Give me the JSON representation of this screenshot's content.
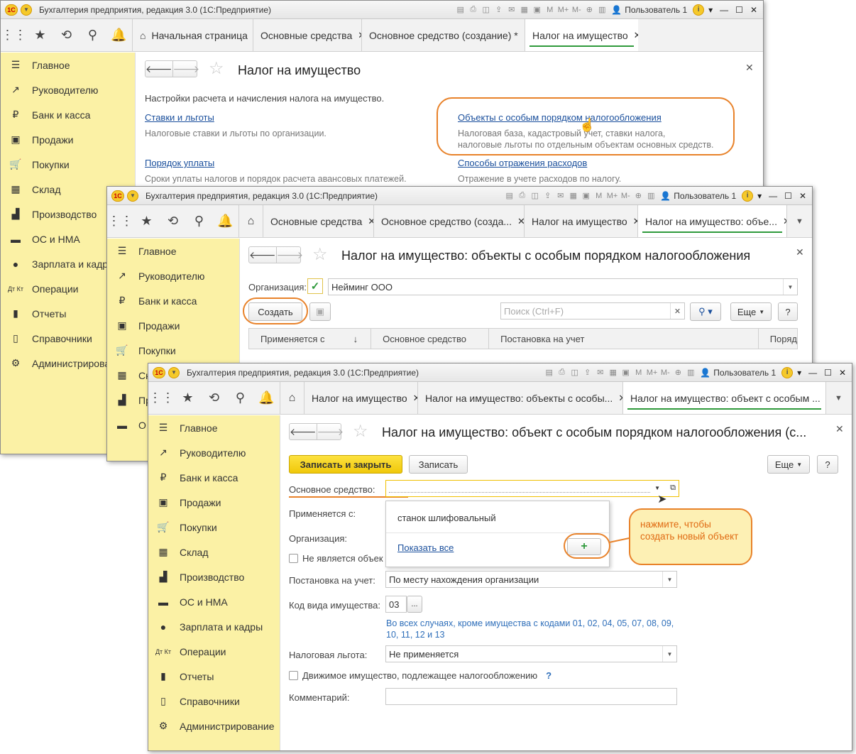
{
  "app_title": "Бухгалтерия предприятия, редакция 3.0 (1С:Предприятие)",
  "user": "Пользователь 1",
  "logo": "1С",
  "sidebar": [
    "Главное",
    "Руководителю",
    "Банк и касса",
    "Продажи",
    "Покупки",
    "Склад",
    "Производство",
    "ОС и НМА",
    "Зарплата и кадры",
    "Операции",
    "Отчеты",
    "Справочники",
    "Администрирование"
  ],
  "sidebar_w1_visible": {
    "zarplata": "Зарплата и кадр",
    "admin": "Администрирова"
  },
  "sidebar_w2_visible": {
    "sklad": "Ск",
    "proizv": "Пр",
    "os": "О"
  },
  "w1": {
    "tabs": [
      "Начальная страница",
      "Основные средства",
      "Основное средство (создание) *",
      "Налог на имущество"
    ],
    "title": "Налог на имущество",
    "intro": "Настройки расчета и начисления налога на имущество.",
    "link1": "Ставки и льготы",
    "hint1": "Налоговые ставки и льготы по организации.",
    "link2": "Объекты с особым порядком налогообложения",
    "hint2a": "Налоговая база, кадастровый учет, ставки налога,",
    "hint2b": "налоговые льготы по отдельным объектам основных средств.",
    "link3": "Порядок уплаты",
    "hint3": "Сроки уплаты налогов и порядок расчета авансовых платежей.",
    "link4": "Способы отражения расходов",
    "hint4": "Отражение в учете расходов по налогу."
  },
  "w2": {
    "tabs": [
      "Основные средства",
      "Основное средство (созда...",
      "Налог на имущество",
      "Налог на имущество: объе..."
    ],
    "title": "Налог на имущество: объекты с особым порядком налогообложения",
    "org_label": "Организация:",
    "org_value": "Нейминг ООО",
    "create": "Создать",
    "search_placeholder": "Поиск (Ctrl+F)",
    "more": "Еще",
    "help": "?",
    "cols": [
      "Применяется с",
      "Основное средство",
      "Постановка на учет",
      "Поряд"
    ],
    "sort_arrow": "↓"
  },
  "w3": {
    "tabs": [
      "Налог на имущество",
      "Налог на имущество: объекты с особы...",
      "Налог на имущество: объект с особым ..."
    ],
    "title": "Налог на имущество: объект с особым порядком налогообложения (с...",
    "save_close": "Записать и закрыть",
    "save": "Записать",
    "more": "Еще",
    "help": "?",
    "os_label": "Основное средство:",
    "applies_label": "Применяется с:",
    "org_label": "Организация:",
    "not_obj": "Не является объек",
    "reg_label": "Постановка на учет:",
    "reg_value": "По месту нахождения организации",
    "code_label": "Код вида имущества:",
    "code_value": "03",
    "code_btn": "...",
    "code_hint": "Во всех случаях, кроме имущества с кодами 01, 02, 04, 05, 07, 08, 09, 10, 11, 12 и 13",
    "benefit_label": "Налоговая льгота:",
    "benefit_value": "Не применяется",
    "movable": "Движимое имущество, подлежащее налогообложению",
    "q": "?",
    "comment_label": "Комментарий:",
    "dropdown_item": "станок шлифовальный",
    "show_all": "Показать все",
    "plus": "+"
  },
  "callout": "нажмите, чтобы создать новый объект",
  "colors": {
    "accent": "#e8822a",
    "sidebar": "#fbf1a5",
    "link": "#1a4f9c",
    "active_tab": "#2f9a3c"
  }
}
